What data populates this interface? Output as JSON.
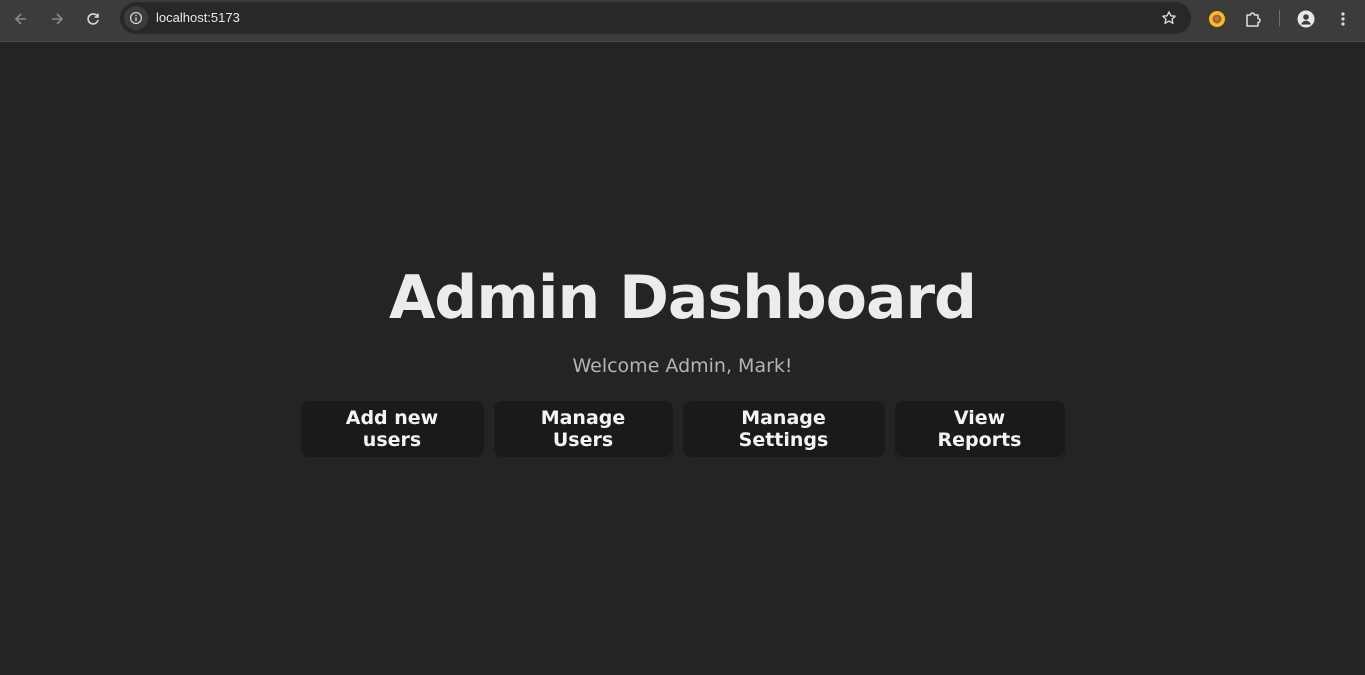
{
  "browser": {
    "url": "localhost:5173",
    "icons": [
      "back-arrow-icon",
      "forward-arrow-icon",
      "reload-icon",
      "site-info-icon",
      "bookmark-star-icon",
      "extension-icon",
      "puzzle-icon",
      "profile-icon",
      "kebab-menu-icon"
    ]
  },
  "page": {
    "title": "Admin Dashboard",
    "welcome": "Welcome Admin, Mark!",
    "buttons": {
      "add_users": "Add new users",
      "manage_users": "Manage Users",
      "manage_settings": "Manage Settings",
      "view_reports": "View Reports"
    }
  },
  "colors": {
    "background": "#242424",
    "button_bg": "#1a1a1a",
    "title": "#ececec",
    "subtitle": "#b4b4b4"
  }
}
